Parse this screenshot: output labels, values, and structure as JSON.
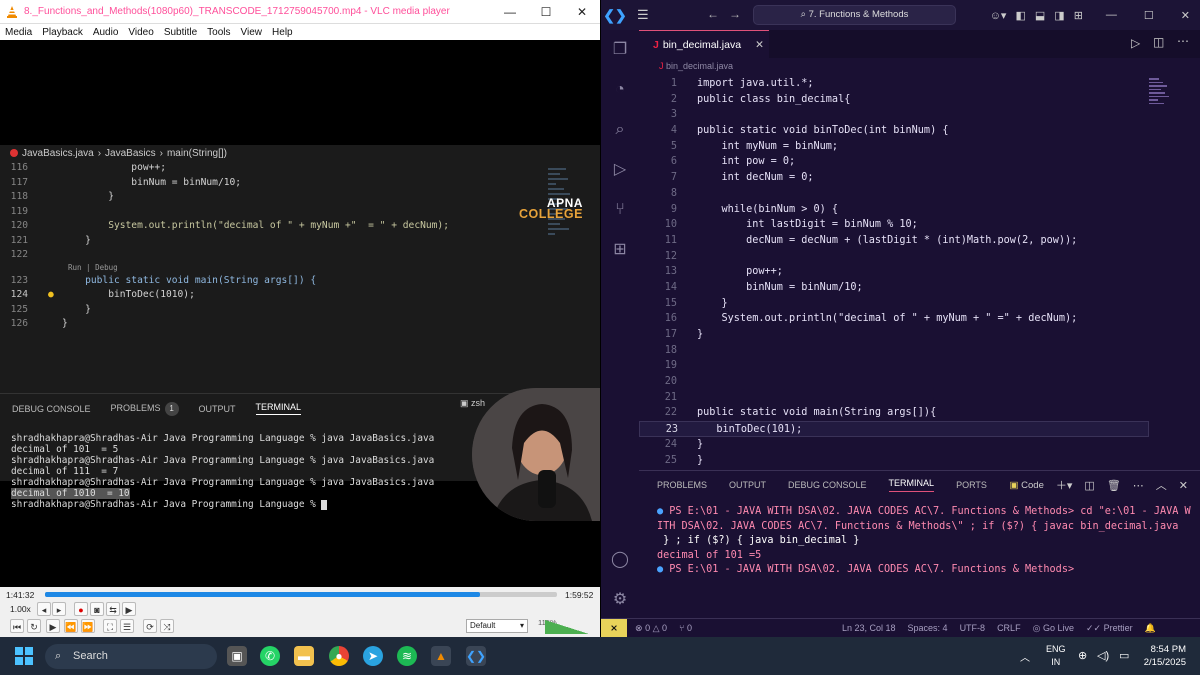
{
  "vlc": {
    "title": "8._Functions_and_Methods(1080p60)_TRANSCODE_1712759045700.mp4 - VLC media player",
    "menu": [
      "Media",
      "Playback",
      "Audio",
      "Video",
      "Subtitle",
      "Tools",
      "View",
      "Help"
    ],
    "time_elapsed": "1:41:32",
    "time_total": "1:59:52",
    "speed": "1.00x",
    "aspect_select": "Default",
    "volume": "115%",
    "seek_progress_percent": 85
  },
  "video_editor": {
    "breadcrumb": [
      "JavaBasics.java",
      "JavaBasics",
      "main(String[])"
    ],
    "code": [
      {
        "n": "116",
        "t": "            pow++;"
      },
      {
        "n": "117",
        "t": "            binNum = binNum/10;"
      },
      {
        "n": "118",
        "t": "        }"
      },
      {
        "n": "119",
        "t": ""
      },
      {
        "n": "120",
        "t": "        System.out.println(\"decimal of \" + myNum +\"  = \" + decNum);"
      },
      {
        "n": "121",
        "t": "    }"
      },
      {
        "n": "122",
        "t": ""
      },
      {
        "n": "123",
        "t": "    public static void main(String args[]) {"
      },
      {
        "n": "124",
        "t": "        binToDec(1010);"
      },
      {
        "n": "125",
        "t": "    }"
      },
      {
        "n": "126",
        "t": "}"
      }
    ],
    "run_debug": "Run | Debug",
    "panel_tabs": [
      "DEBUG CONSOLE",
      "PROBLEMS",
      "OUTPUT",
      "TERMINAL"
    ],
    "problems_count": "1",
    "shell": "zsh",
    "terminal": [
      "shradhakhapra@Shradhas-Air Java Programming Language % java JavaBasics.java",
      "decimal of 101  = 5",
      "shradhakhapra@Shradhas-Air Java Programming Language % java JavaBasics.java",
      "decimal of 111  = 7",
      "shradhakhapra@Shradhas-Air Java Programming Language % java JavaBasics.java",
      "decimal of 1010  = 10",
      "shradhakhapra@Shradhas-Air Java Programming Language % "
    ],
    "watermark_top": "APNA",
    "watermark_bottom": "COLLEGE"
  },
  "vscode": {
    "search": "7. Functions & Methods",
    "tab": "bin_decimal.java",
    "breadcrumb": "bin_decimal.java",
    "code": [
      {
        "n": "1",
        "t": "import java.util.*;"
      },
      {
        "n": "2",
        "t": "public class bin_decimal{"
      },
      {
        "n": "3",
        "t": ""
      },
      {
        "n": "4",
        "t": "public static void binToDec(int binNum) {"
      },
      {
        "n": "5",
        "t": "    int myNum = binNum;"
      },
      {
        "n": "6",
        "t": "    int pow = 0;"
      },
      {
        "n": "7",
        "t": "    int decNum = 0;"
      },
      {
        "n": "8",
        "t": ""
      },
      {
        "n": "9",
        "t": "    while(binNum > 0) {"
      },
      {
        "n": "10",
        "t": "        int lastDigit = binNum % 10;"
      },
      {
        "n": "11",
        "t": "        decNum = decNum + (lastDigit * (int)Math.pow(2, pow));"
      },
      {
        "n": "12",
        "t": ""
      },
      {
        "n": "13",
        "t": "        pow++;"
      },
      {
        "n": "14",
        "t": "        binNum = binNum/10;"
      },
      {
        "n": "15",
        "t": "    }"
      },
      {
        "n": "16",
        "t": "    System.out.println(\"decimal of \" + myNum + \" =\" + decNum);"
      },
      {
        "n": "17",
        "t": "}"
      },
      {
        "n": "18",
        "t": ""
      },
      {
        "n": "19",
        "t": ""
      },
      {
        "n": "20",
        "t": ""
      },
      {
        "n": "21",
        "t": ""
      },
      {
        "n": "22",
        "t": "public static void main(String args[]){"
      },
      {
        "n": "23",
        "t": "   binToDec(101);"
      },
      {
        "n": "24",
        "t": "}"
      },
      {
        "n": "25",
        "t": "}"
      }
    ],
    "panel_tabs": [
      "PROBLEMS",
      "OUTPUT",
      "DEBUG CONSOLE",
      "TERMINAL",
      "PORTS"
    ],
    "terminal_profile": "Code",
    "terminal": [
      "PS E:\\01 - JAVA WITH DSA\\02. JAVA CODES AC\\7. Functions & Methods> cd \"e:\\01 - JAVA W",
      "ITH DSA\\02. JAVA CODES AC\\7. Functions & Methods\\\" ; if ($?) { javac bin_decimal.java",
      " } ; if ($?) { java bin_decimal }",
      "decimal of 101 =5",
      "PS E:\\01 - JAVA WITH DSA\\02. JAVA CODES AC\\7. Functions & Methods>"
    ],
    "status": {
      "errors": "0",
      "warnings": "0",
      "ports": "0",
      "position": "Ln 23, Col 18",
      "spaces": "Spaces: 4",
      "encoding": "UTF-8",
      "eol": "CRLF",
      "golive": "Go Live",
      "prettier": "Prettier"
    }
  },
  "taskbar": {
    "search": "Search",
    "lang1": "ENG",
    "lang2": "IN",
    "time": "8:54 PM",
    "date": "2/15/2025"
  }
}
